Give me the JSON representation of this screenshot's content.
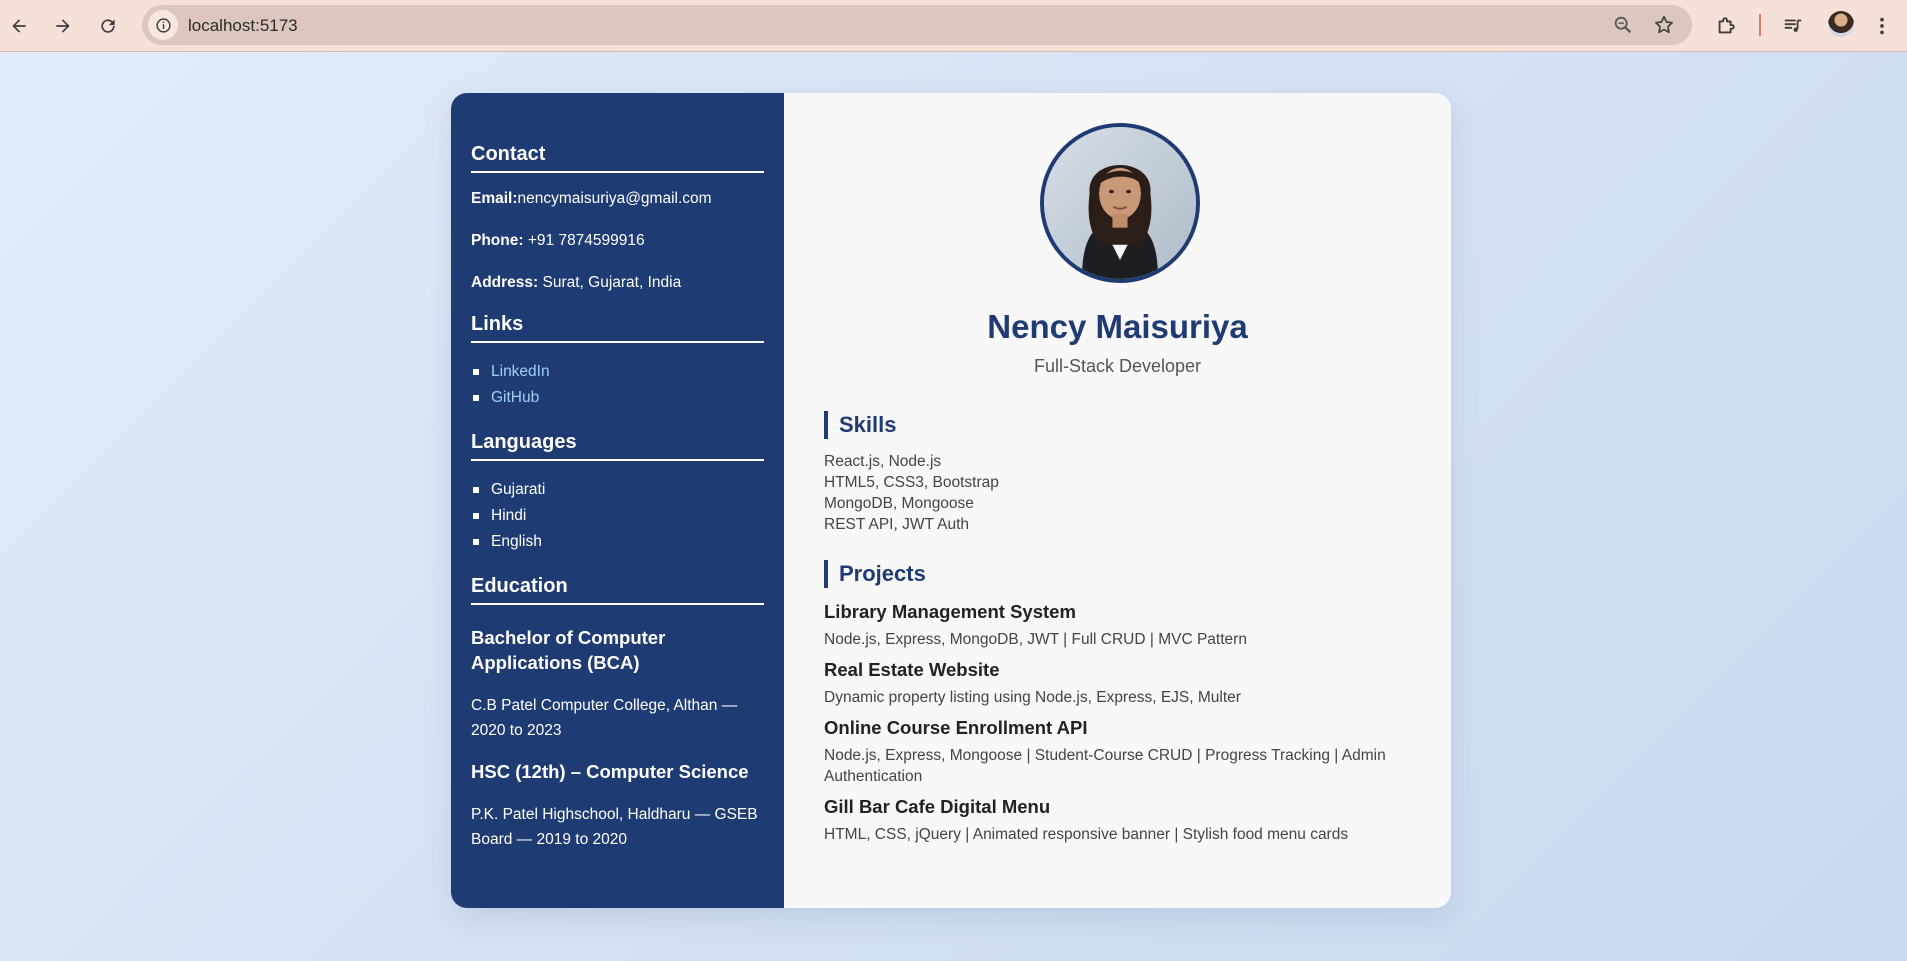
{
  "browser": {
    "url": "localhost:5173"
  },
  "resume": {
    "name": "Nency Maisuriya",
    "role": "Full-Stack Developer",
    "contact": {
      "heading": "Contact",
      "email_label": "Email:",
      "email": "nencymaisuriya@gmail.com",
      "phone_label": "Phone:",
      "phone": "+91 7874599916",
      "address_label": "Address:",
      "address": "Surat, Gujarat, India"
    },
    "links": {
      "heading": "Links",
      "items": [
        "LinkedIn",
        "GitHub"
      ]
    },
    "languages": {
      "heading": "Languages",
      "items": [
        "Gujarati",
        "Hindi",
        "English"
      ]
    },
    "education": {
      "heading": "Education",
      "items": [
        {
          "degree": "Bachelor of Computer Applications (BCA)",
          "detail": "C.B Patel Computer College, Althan — 2020 to 2023"
        },
        {
          "degree": "HSC (12th) – Computer Science",
          "detail": "P.K. Patel Highschool, Haldharu — GSEB Board — 2019 to 2020"
        }
      ]
    },
    "skills": {
      "heading": "Skills",
      "items": [
        "React.js, Node.js",
        "HTML5, CSS3, Bootstrap",
        "MongoDB, Mongoose",
        "REST API, JWT Auth"
      ]
    },
    "projects": {
      "heading": "Projects",
      "items": [
        {
          "title": "Library Management System",
          "desc": "Node.js, Express, MongoDB, JWT | Full CRUD | MVC Pattern"
        },
        {
          "title": "Real Estate Website",
          "desc": "Dynamic property listing using Node.js, Express, EJS, Multer"
        },
        {
          "title": "Online Course Enrollment API",
          "desc": "Node.js, Express, Mongoose | Student-Course CRUD | Progress Tracking | Admin Authentication"
        },
        {
          "title": "Gill Bar Cafe Digital Menu",
          "desc": "HTML, CSS, jQuery | Animated responsive banner | Stylish food menu cards"
        }
      ]
    }
  },
  "colors": {
    "sidebar": "#1f3b73",
    "accent": "#1f3b73",
    "link": "#9fd0f5",
    "browser_toolbar": "#f6e1d9"
  }
}
